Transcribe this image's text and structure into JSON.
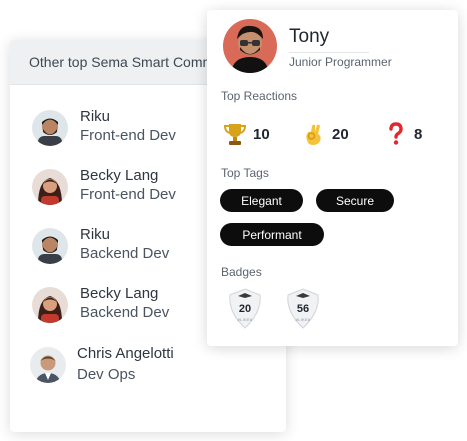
{
  "list": {
    "header": "Other top Sema Smart Comm",
    "items": [
      {
        "name": "Riku",
        "role": "Front-end Dev",
        "avatar": "man-avatar"
      },
      {
        "name": "Becky Lang",
        "role": "Front-end Dev",
        "avatar": "woman-avatar"
      },
      {
        "name": "Riku",
        "role": "Backend Dev",
        "avatar": "man-avatar"
      },
      {
        "name": "Becky Lang",
        "role": "Backend Dev",
        "avatar": "woman-avatar"
      },
      {
        "name": "Chris Angelotti",
        "role": "Dev Ops",
        "avatar": "man-suit-avatar"
      }
    ]
  },
  "profile": {
    "name": "Tony",
    "title": "Junior Programmer",
    "top_reactions_label": "Top Reactions",
    "reactions": [
      {
        "icon": "trophy-icon",
        "count": "10"
      },
      {
        "icon": "ok-hand-icon",
        "count": "20"
      },
      {
        "icon": "question-mark-icon",
        "count": "8"
      }
    ],
    "top_tags_label": "Top Tags",
    "tags": [
      "Elegant",
      "Secure",
      "Performant"
    ],
    "badges_label": "Badges",
    "badges": [
      {
        "number": "20",
        "subtext": "#LIKE#"
      },
      {
        "number": "56",
        "subtext": "#LIKE#"
      }
    ]
  },
  "colors": {
    "tag_bg": "#0d0d0d",
    "header_bg": "#eef0f2",
    "trophy": "#d9a21b",
    "question": "#e3262b"
  }
}
